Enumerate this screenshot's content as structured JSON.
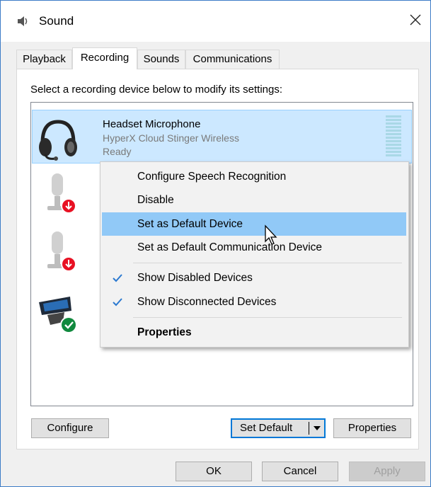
{
  "window": {
    "title": "Sound"
  },
  "tabs": [
    {
      "label": "Playback"
    },
    {
      "label": "Recording"
    },
    {
      "label": "Sounds"
    },
    {
      "label": "Communications"
    }
  ],
  "active_tab": "Recording",
  "instruction": "Select a recording device below to modify its settings:",
  "devices": [
    {
      "name": "Headset Microphone",
      "description": "HyperX Cloud Stinger Wireless",
      "status": "Ready",
      "icon": "headset-icon",
      "selected": true
    },
    {
      "icon": "microphone-disconnected-icon"
    },
    {
      "icon": "microphone-disconnected-icon"
    },
    {
      "icon": "webcam-default-icon"
    }
  ],
  "context_menu": [
    {
      "label": "Configure Speech Recognition"
    },
    {
      "label": "Disable"
    },
    {
      "label": "Set as Default Device",
      "highlighted": true
    },
    {
      "label": "Set as Default Communication Device"
    },
    {
      "label": "Show Disabled Devices",
      "checked": true
    },
    {
      "label": "Show Disconnected Devices",
      "checked": true
    },
    {
      "label": "Properties",
      "bold": true
    }
  ],
  "buttons": {
    "configure": "Configure",
    "set_default": "Set Default",
    "properties": "Properties",
    "ok": "OK",
    "cancel": "Cancel",
    "apply": "Apply"
  },
  "colors": {
    "accent": "#0078d7",
    "selection": "#cce8ff",
    "menu_highlight": "#91c9f7",
    "check": "#2b79d0",
    "badge_red": "#e81123",
    "badge_green": "#10893e"
  }
}
